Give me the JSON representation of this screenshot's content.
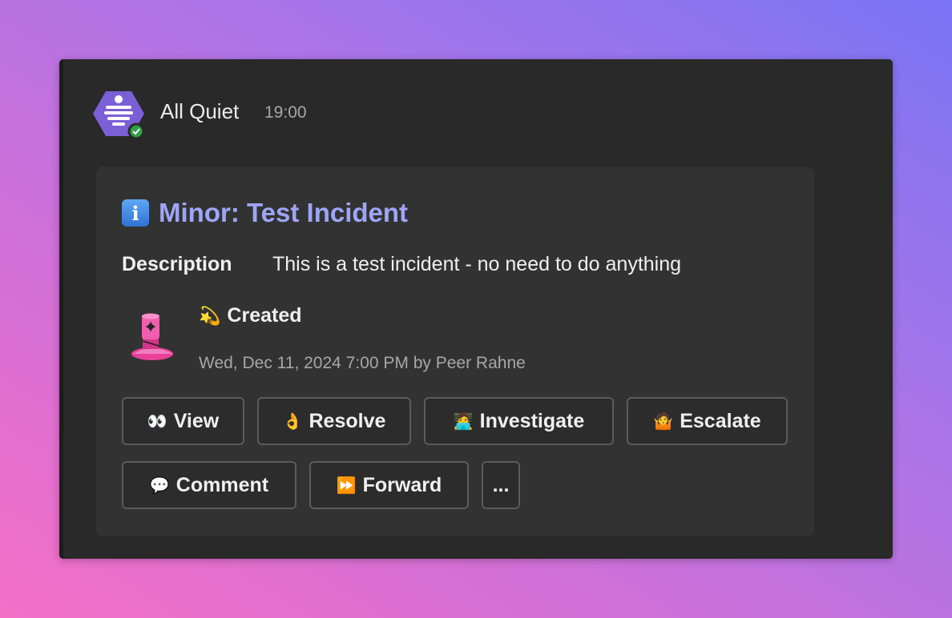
{
  "message": {
    "sender": "All Quiet",
    "time": "19:00",
    "status": "online",
    "colors": {
      "avatar": "#7b5fd6",
      "status_badge": "#2ea043",
      "title": "#9fa5f6"
    }
  },
  "card": {
    "title_icon": "information-icon",
    "title": "Minor: Test Incident",
    "description_label": "Description",
    "description_value": "This is a test incident - no need to do anything",
    "event": {
      "icon": "dizzy-emoji",
      "emoji": "💫",
      "title": "Created",
      "meta": "Wed, Dec 11, 2024 7:00 PM by Peer Rahne",
      "image": "pink-plunger-illustration"
    },
    "actions": [
      {
        "emoji": "👀",
        "icon": "eyes-emoji",
        "label": "View"
      },
      {
        "emoji": "👌",
        "icon": "ok-hand-emoji",
        "label": "Resolve"
      },
      {
        "emoji": "🧑‍💻",
        "icon": "technologist-emoji",
        "label": "Investigate"
      },
      {
        "emoji": "🤷",
        "icon": "shrug-emoji",
        "label": "Escalate"
      },
      {
        "emoji": "💬",
        "icon": "speech-bubble-emoji",
        "label": "Comment"
      },
      {
        "emoji": "⏩",
        "icon": "fast-forward-emoji",
        "label": "Forward"
      },
      {
        "emoji": "",
        "icon": "",
        "label": "..."
      }
    ]
  }
}
